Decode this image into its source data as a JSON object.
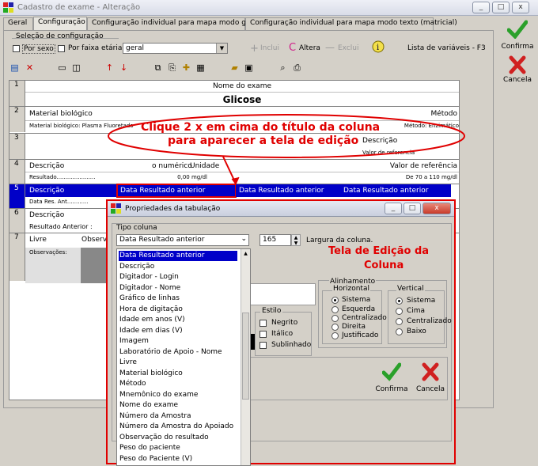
{
  "window": {
    "title": "Cadastro de exame - Alteração",
    "buttons": [
      "_",
      "□",
      "x"
    ]
  },
  "tabs": [
    {
      "label": "Geral"
    },
    {
      "label": "Configuração"
    },
    {
      "label": "Configuração individual para mapa modo gráfico"
    },
    {
      "label": "Configuração individual para mapa modo texto (matricial)"
    }
  ],
  "selection": {
    "title": "Seleção de configuração",
    "por_sexo": "Por sexo",
    "por_faixa": "Por faixa etária",
    "combo_value": "geral",
    "incluir": "Inclui",
    "alterar": "Altera",
    "excluir": "Exclui",
    "vars_label": "Lista de variáveis - F3"
  },
  "right_panel": {
    "confirma": "Confirma",
    "cancela": "Cancela"
  },
  "grid": {
    "r1": {
      "num": "1",
      "label": "Nome do exame",
      "title": "Glicose"
    },
    "r2": {
      "num": "2",
      "label": "Material biológico",
      "right": "Método",
      "sub_left": "Material biológico: Plasma Fluoretado",
      "sub_right": "Método: Enzimático"
    },
    "r3": {
      "num": "3",
      "right1": "Descrição",
      "right2": "Valor de referencia"
    },
    "r4": {
      "num": "4",
      "c1": "Descrição",
      "c2": "o numérico",
      "c2b": "Unidade",
      "c3": "Valor de referência",
      "sub1": "Resultado......................",
      "sub2": "0,00 mg/dl",
      "sub3": "De 70 a 110 mg/dl"
    },
    "r5": {
      "num": "5",
      "c1": "Descrição",
      "c2": "Data Resultado anterior",
      "c3": "Data Resultado anterior",
      "c4": "Data Resultado anterior",
      "sub": "Data Res. Ant............"
    },
    "r6": {
      "num": "6",
      "c1": "Descrição",
      "sub": "Resultado Anterior :"
    },
    "r7": {
      "num": "7",
      "c1": "Livre",
      "c2": "Observ",
      "obs": "Observações:"
    }
  },
  "callout": {
    "line1": "Clique 2 x em cima do título da coluna",
    "line2": "para aparecer a tela de edição"
  },
  "dialog": {
    "title": "Propriedades da tabulação",
    "tipo_label": "Tipo coluna",
    "tipo_value": "Data Resultado anterior",
    "largura_value": "165",
    "largura_label": "Largura da coluna.",
    "edit_note_1": "Tela de Edição da",
    "edit_note_2": "Coluna",
    "estilo": {
      "title": "Estilo",
      "negrito": "Negrito",
      "italico": "Itálico",
      "sublinhado": "Sublinhado"
    },
    "alinhamento": {
      "title": "Alinhamento",
      "horizontal": "Horizontal",
      "h_options": [
        "Sistema",
        "Esquerda",
        "Centralizado",
        "Direita",
        "Justificado"
      ],
      "vertical": "Vertical",
      "v_options": [
        "Sistema",
        "Cima",
        "Centralizado",
        "Baixo"
      ]
    },
    "confirma": "Confirma",
    "cancela": "Cancela",
    "list_items": [
      "Data Resultado anterior",
      "Descrição",
      "Digitador - Login",
      "Digitador - Nome",
      "Gráfico de linhas",
      "Hora de digitação",
      "Idade em anos (V)",
      "Idade em dias (V)",
      "Imagem",
      "Laboratório de Apoio - Nome",
      "Livre",
      "Material biológico",
      "Método",
      "Mnemônico do exame",
      "Nome do exame",
      "Número da Amostra",
      "Número da Amostra do Apoiado",
      "Observação do resultado",
      "Peso do paciente",
      "Peso do Paciente (V)"
    ]
  },
  "colors": {
    "accent_red": "#e00000",
    "selection_blue": "#0000c8",
    "check_green": "#2aa02a"
  }
}
